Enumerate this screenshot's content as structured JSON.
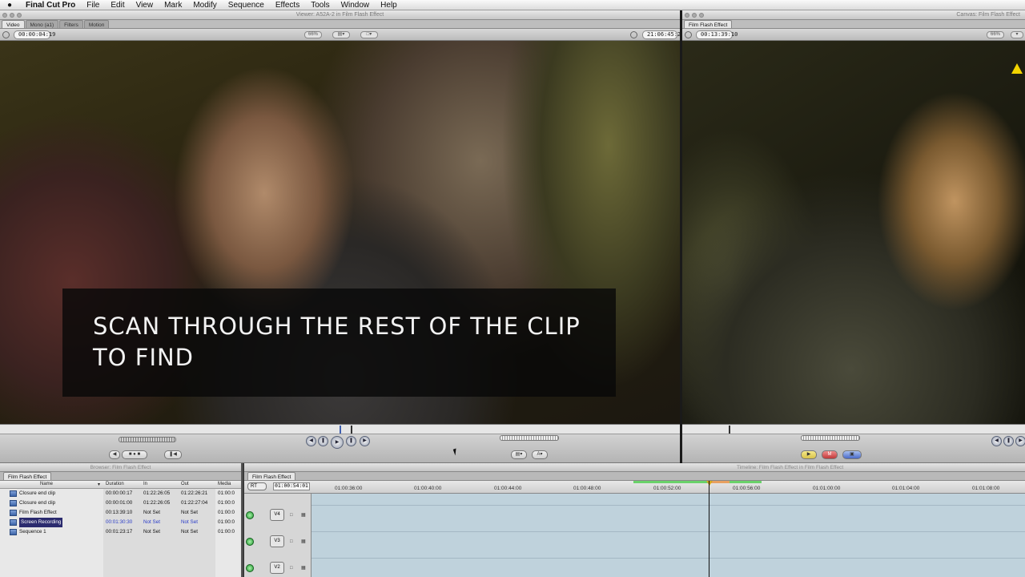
{
  "menubar": {
    "apple": "",
    "app": "Final Cut Pro",
    "items": [
      "File",
      "Edit",
      "View",
      "Mark",
      "Modify",
      "Sequence",
      "Effects",
      "Tools",
      "Window",
      "Help"
    ]
  },
  "viewer": {
    "title": "Viewer: A52A-2 in Film Flash Effect",
    "tabs": [
      "Video",
      "Mono (a1)",
      "Filters",
      "Motion"
    ],
    "timecode_duration": "00:00:04:19",
    "zoom": "66%",
    "timecode_current": "21:06:45:23"
  },
  "canvas": {
    "title": "Canvas: Film Flash Effect",
    "tabs": [
      "Film Flash Effect"
    ],
    "timecode_duration": "00:13:39:10",
    "zoom": "66%"
  },
  "overlay": {
    "caption": "SCAN THROUGH THE REST OF THE CLIP TO FIND"
  },
  "browser": {
    "title": "Browser: Film Flash Effect",
    "tab": "Film Flash Effect",
    "columns": [
      "Name",
      "Duration",
      "In",
      "Out",
      "Media"
    ],
    "rows": [
      {
        "name": "Closure end clip",
        "duration": "00:00:00:17",
        "in": "01:22:26:05",
        "out": "01:22:26:21",
        "media": "01:00:0"
      },
      {
        "name": "Closure end clip",
        "duration": "00:00:01:00",
        "in": "01:22:26:05",
        "out": "01:22:27:04",
        "media": "01:00:0"
      },
      {
        "name": "Film Flash Effect",
        "duration": "00:13:39:10",
        "in": "Not Set",
        "out": "Not Set",
        "media": "01:00:0"
      },
      {
        "name": "Screen Recording",
        "duration": "00:01:30:30",
        "in": "Not Set",
        "out": "Not Set",
        "media": "01:00:0"
      },
      {
        "name": "Sequence 1",
        "duration": "00:01:23:17",
        "in": "Not Set",
        "out": "Not Set",
        "media": "01:00:0"
      }
    ]
  },
  "timeline": {
    "title": "Timeline: Film Flash Effect in Film Flash Effect",
    "tab": "Film Flash Effect",
    "rt": "RT",
    "timecode": "01:00:54:01",
    "ruler": [
      "01:00:36:00",
      "01:00:40:00",
      "01:00:44:00",
      "01:00:48:00",
      "01:00:52:00",
      "01:00:56:00",
      "01:01:00:00",
      "01:01:04:00",
      "01:01:08:00"
    ],
    "tracks": [
      "V4",
      "V3",
      "V2"
    ]
  },
  "colors": {
    "accent_green": "#1f9a2f",
    "render_green": "#6ad26a",
    "render_orange": "#e8a060",
    "selection": "#2b2b6e",
    "warning": "#f3d400"
  }
}
